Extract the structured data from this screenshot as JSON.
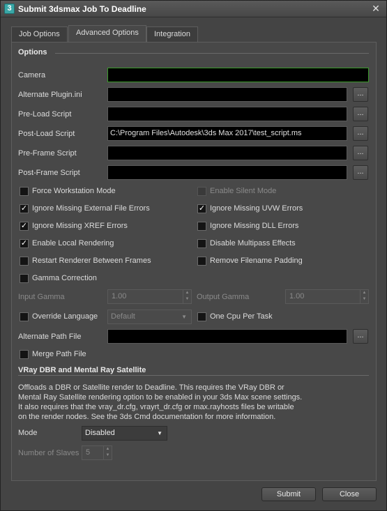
{
  "window": {
    "title": "Submit 3dsmax Job To Deadline",
    "icon_label": "3",
    "close_glyph": "✕"
  },
  "tabs": [
    {
      "label": "Job Options",
      "active": false
    },
    {
      "label": "Advanced Options",
      "active": true
    },
    {
      "label": "Integration",
      "active": false
    }
  ],
  "options": {
    "heading": "Options",
    "camera": {
      "label": "Camera",
      "value": ""
    },
    "paths": [
      {
        "label": "Alternate Plugin.ini",
        "value": "",
        "browse": "..."
      },
      {
        "label": "Pre-Load Script",
        "value": "",
        "browse": "..."
      },
      {
        "label": "Post-Load Script",
        "value": "C:\\Program Files\\Autodesk\\3ds Max 2017\\test_script.ms",
        "browse": "..."
      },
      {
        "label": "Pre-Frame Script",
        "value": "",
        "browse": "..."
      },
      {
        "label": "Post-Frame Script",
        "value": "",
        "browse": "..."
      }
    ],
    "checks_left": [
      {
        "label": "Force Workstation Mode",
        "checked": false
      },
      {
        "label": "Ignore Missing External File Errors",
        "checked": true
      },
      {
        "label": "Ignore Missing XREF Errors",
        "checked": true
      },
      {
        "label": "Enable Local Rendering",
        "checked": true
      },
      {
        "label": "Restart Renderer Between Frames",
        "checked": false
      },
      {
        "label": "Gamma Correction",
        "checked": false
      }
    ],
    "checks_right": [
      {
        "label": "Enable Silent Mode",
        "checked": false,
        "disabled": true
      },
      {
        "label": "Ignore Missing UVW Errors",
        "checked": true,
        "disabled": false
      },
      {
        "label": "Ignore Missing DLL Errors",
        "checked": false,
        "disabled": false
      },
      {
        "label": "Disable Multipass Effects",
        "checked": false,
        "disabled": false
      },
      {
        "label": "Remove Filename Padding",
        "checked": false,
        "disabled": false
      }
    ],
    "input_gamma": {
      "label": "Input Gamma",
      "value": "1.00"
    },
    "output_gamma": {
      "label": "Output Gamma",
      "value": "1.00"
    },
    "override_language": {
      "label": "Override Language",
      "checked": false,
      "value": "Default"
    },
    "one_cpu": {
      "label": "One Cpu Per Task",
      "checked": false
    },
    "alt_path": {
      "label": "Alternate Path File",
      "value": "",
      "browse": "..."
    },
    "merge_path": {
      "label": "Merge Path File",
      "checked": false
    }
  },
  "vray": {
    "heading": "VRay DBR and Mental Ray Satellite",
    "description": "Offloads a DBR or Satellite render to Deadline. This requires the VRay DBR or\nMental Ray Satellite rendering option to be enabled in your 3ds Max scene settings.\nIt also requires that the vray_dr.cfg, vrayrt_dr.cfg or max.rayhosts files be writable\non the render nodes. See the 3ds Cmd documentation for more information.",
    "mode": {
      "label": "Mode",
      "value": "Disabled"
    },
    "slaves": {
      "label": "Number of Slaves",
      "value": "5"
    }
  },
  "footer": {
    "submit": "Submit",
    "close": "Close"
  },
  "icons": {
    "check": "✓",
    "arrow_down": "▼",
    "arrow_up": "▲"
  }
}
